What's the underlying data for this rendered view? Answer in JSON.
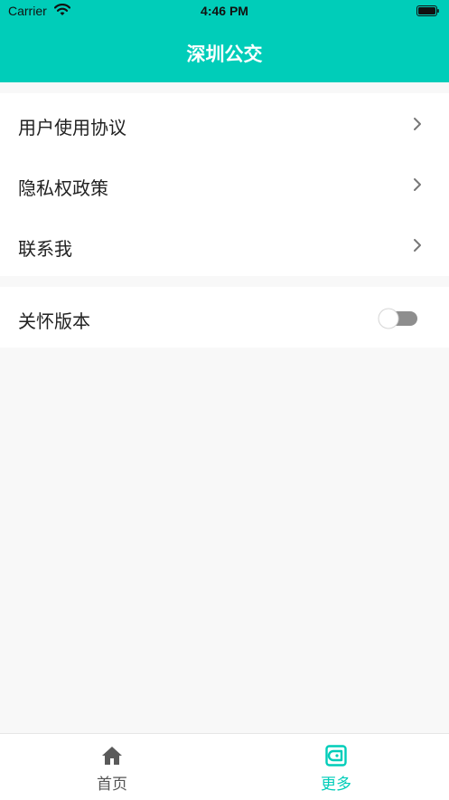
{
  "status_bar": {
    "carrier": "Carrier",
    "time": "4:46 PM",
    "wifi_icon": "wifi-icon",
    "battery_icon": "battery-icon"
  },
  "header": {
    "title": "深圳公交"
  },
  "settings": {
    "group1": [
      {
        "label": "用户使用协议",
        "icon": "chevron-right-icon"
      },
      {
        "label": "隐私权政策",
        "icon": "chevron-right-icon"
      },
      {
        "label": "联系我",
        "icon": "chevron-right-icon"
      }
    ],
    "group2": [
      {
        "label": "关怀版本",
        "toggle_on": false
      }
    ]
  },
  "tabbar": {
    "items": [
      {
        "label": "首页",
        "icon": "home-icon",
        "active": false
      },
      {
        "label": "更多",
        "icon": "wallet-icon",
        "active": true
      }
    ]
  },
  "colors": {
    "primary": "#00cdb9",
    "background": "#f8f8f8",
    "text": "#222222",
    "inactive": "#555555"
  }
}
